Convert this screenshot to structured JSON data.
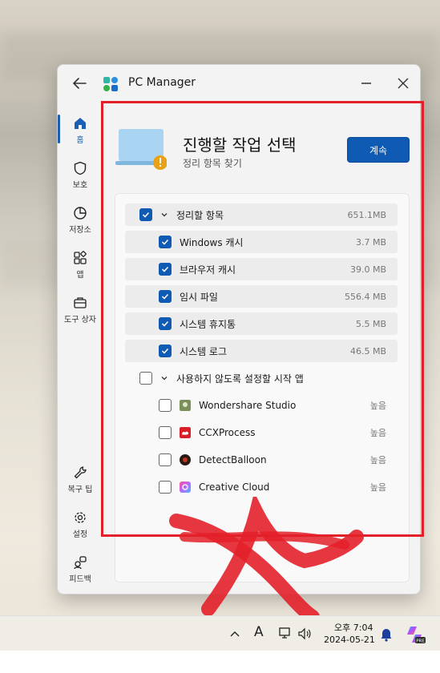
{
  "window": {
    "title": "PC Manager"
  },
  "sidebar": {
    "items": [
      {
        "label": "홈",
        "icon": "home-icon"
      },
      {
        "label": "보호",
        "icon": "shield-icon"
      },
      {
        "label": "저장소",
        "icon": "pie-chart-icon"
      },
      {
        "label": "앱",
        "icon": "apps-icon"
      },
      {
        "label": "도구 상자",
        "icon": "toolbox-icon"
      },
      {
        "label": "복구 팁",
        "icon": "wrench-icon"
      },
      {
        "label": "설정",
        "icon": "gear-icon"
      },
      {
        "label": "피드백",
        "icon": "feedback-icon"
      }
    ]
  },
  "header": {
    "title": "진행할 작업 선택",
    "subtitle": "정리 항목 찾기",
    "continue_label": "계속"
  },
  "cleanup": {
    "group_label": "정리할 항목",
    "group_size": "651.1MB",
    "items": [
      {
        "label": "Windows 캐시",
        "size": "3.7 MB",
        "checked": true
      },
      {
        "label": "브라우저 캐시",
        "size": "39.0 MB",
        "checked": true
      },
      {
        "label": "임시 파일",
        "size": "556.4 MB",
        "checked": true
      },
      {
        "label": "시스템 휴지통",
        "size": "5.5 MB",
        "checked": true
      },
      {
        "label": "시스템 로그",
        "size": "46.5 MB",
        "checked": true
      }
    ]
  },
  "startup": {
    "group_label": "사용하지 않도록 설정할 시작 앱",
    "apps": [
      {
        "label": "Wondershare Studio",
        "impact": "높음",
        "checked": false
      },
      {
        "label": "CCXProcess",
        "impact": "높음",
        "checked": false
      },
      {
        "label": "DetectBalloon",
        "impact": "높음",
        "checked": false
      },
      {
        "label": "Creative Cloud",
        "impact": "높음",
        "checked": false
      }
    ]
  },
  "taskbar": {
    "ime_label": "A",
    "time": "오후 7:04",
    "date": "2024-05-21"
  },
  "colors": {
    "accent": "#0f5ab3",
    "annotation_red": "#e3202a"
  }
}
